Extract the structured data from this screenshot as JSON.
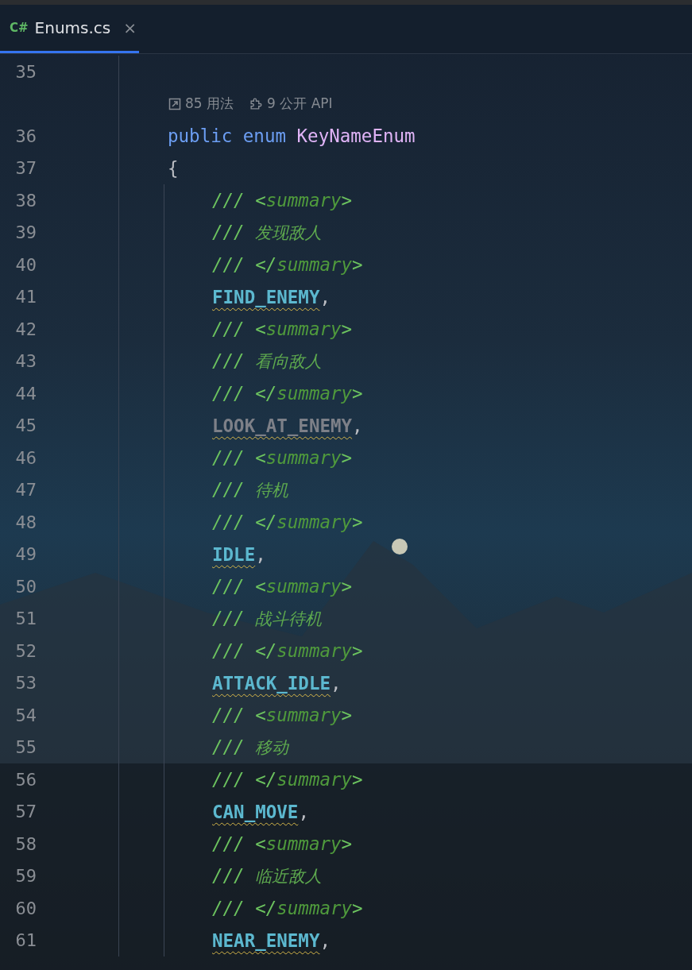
{
  "tabs": [
    {
      "lang": "C#",
      "label": "Enums.cs",
      "close": "×",
      "selected": true
    }
  ],
  "lines": [
    {
      "kind": "blank",
      "number": "35"
    },
    {
      "kind": "hints",
      "usages": "85 用法",
      "api": "9 公开 API"
    },
    {
      "kind": "decl",
      "number": "36",
      "keywords": [
        "public",
        "enum"
      ],
      "name": "KeyNameEnum"
    },
    {
      "kind": "brace",
      "number": "37",
      "text": "{",
      "children": [
        {
          "kind": "doc-tag",
          "number": "38",
          "prefix": "///",
          "open": "<",
          "tag": "summary",
          "close": ">"
        },
        {
          "kind": "doc-text",
          "number": "39",
          "prefix": "///",
          "text": "发现敌人"
        },
        {
          "kind": "doc-tag",
          "number": "40",
          "prefix": "///",
          "open": "</",
          "tag": "summary",
          "close": ">"
        },
        {
          "kind": "member",
          "number": "41",
          "name": "FIND_ENEMY",
          "punct": ",",
          "unused": false,
          "warning": true
        },
        {
          "kind": "doc-tag",
          "number": "42",
          "prefix": "///",
          "open": "<",
          "tag": "summary",
          "close": ">"
        },
        {
          "kind": "doc-text",
          "number": "43",
          "prefix": "///",
          "text": "看向敌人"
        },
        {
          "kind": "doc-tag",
          "number": "44",
          "prefix": "///",
          "open": "</",
          "tag": "summary",
          "close": ">"
        },
        {
          "kind": "member",
          "number": "45",
          "name": "LOOK_AT_ENEMY",
          "punct": ",",
          "unused": true,
          "warning": true
        },
        {
          "kind": "doc-tag",
          "number": "46",
          "prefix": "///",
          "open": "<",
          "tag": "summary",
          "close": ">"
        },
        {
          "kind": "doc-text",
          "number": "47",
          "prefix": "///",
          "text": "待机"
        },
        {
          "kind": "doc-tag",
          "number": "48",
          "prefix": "///",
          "open": "</",
          "tag": "summary",
          "close": ">"
        },
        {
          "kind": "member",
          "number": "49",
          "name": "IDLE",
          "punct": ",",
          "unused": false,
          "warning": true
        },
        {
          "kind": "doc-tag",
          "number": "50",
          "prefix": "///",
          "open": "<",
          "tag": "summary",
          "close": ">"
        },
        {
          "kind": "doc-text",
          "number": "51",
          "prefix": "///",
          "text": "战斗待机"
        },
        {
          "kind": "doc-tag",
          "number": "52",
          "prefix": "///",
          "open": "</",
          "tag": "summary",
          "close": ">"
        },
        {
          "kind": "member",
          "number": "53",
          "name": "ATTACK_IDLE",
          "punct": ",",
          "unused": false,
          "warning": true
        },
        {
          "kind": "doc-tag",
          "number": "54",
          "prefix": "///",
          "open": "<",
          "tag": "summary",
          "close": ">"
        },
        {
          "kind": "doc-text",
          "number": "55",
          "prefix": "///",
          "text": "移动"
        },
        {
          "kind": "doc-tag",
          "number": "56",
          "prefix": "///",
          "open": "</",
          "tag": "summary",
          "close": ">"
        },
        {
          "kind": "member",
          "number": "57",
          "name": "CAN_MOVE",
          "punct": ",",
          "unused": false,
          "warning": true
        },
        {
          "kind": "doc-tag",
          "number": "58",
          "prefix": "///",
          "open": "<",
          "tag": "summary",
          "close": ">"
        },
        {
          "kind": "doc-text",
          "number": "59",
          "prefix": "///",
          "text": "临近敌人"
        },
        {
          "kind": "doc-tag",
          "number": "60",
          "prefix": "///",
          "open": "</",
          "tag": "summary",
          "close": ">"
        },
        {
          "kind": "member",
          "number": "61",
          "name": "NEAR_ENEMY",
          "punct": ",",
          "unused": false,
          "warning": true
        }
      ]
    }
  ]
}
